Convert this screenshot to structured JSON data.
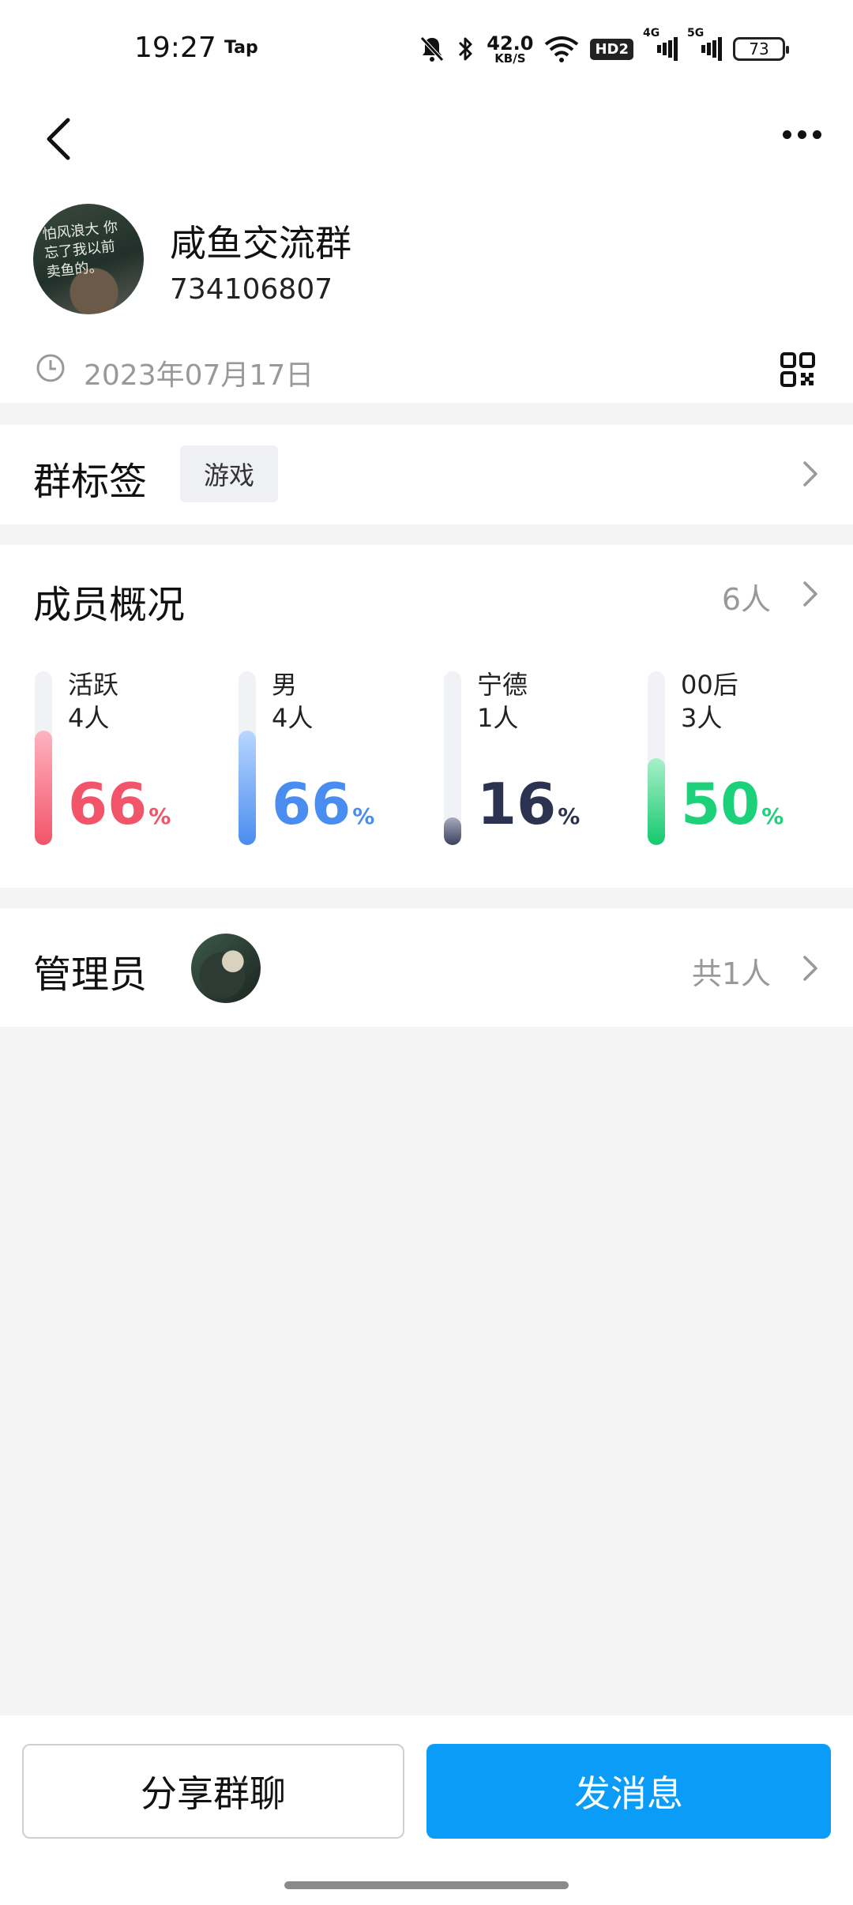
{
  "status_bar": {
    "time": "19:27",
    "app_tag": "Tap",
    "net_speed_value": "42.0",
    "net_speed_unit": "KB/S",
    "hd_label": "HD2",
    "sim1_label": "4G",
    "sim2_label": "5G",
    "battery": "73"
  },
  "group": {
    "name": "咸鱼交流群",
    "id": "734106807",
    "created_date": "2023年07月17日",
    "avatar_text": "怕风浪大 你忘了我以前 卖鱼的。"
  },
  "tags": {
    "title": "群标签",
    "items": [
      "游戏"
    ]
  },
  "members": {
    "title": "成员概况",
    "count": "6人",
    "stats": [
      {
        "label": "活跃",
        "count": "4人",
        "percent": 66,
        "percent_sign": "%",
        "color": "#f2546a",
        "fill_top": "#ffb3c0",
        "fill_bottom": "#f2546a"
      },
      {
        "label": "男",
        "count": "4人",
        "percent": 66,
        "percent_sign": "%",
        "color": "#4a8df0",
        "fill_top": "#b9d6ff",
        "fill_bottom": "#4a8df0"
      },
      {
        "label": "宁德",
        "count": "1人",
        "percent": 16,
        "percent_sign": "%",
        "color": "#2b3350",
        "fill_top": "#a7abbd",
        "fill_bottom": "#3a4160"
      },
      {
        "label": "00后",
        "count": "3人",
        "percent": 50,
        "percent_sign": "%",
        "color": "#1dd17a",
        "fill_top": "#a9f0c9",
        "fill_bottom": "#14c96e"
      }
    ]
  },
  "admins": {
    "title": "管理员",
    "count": "共1人"
  },
  "actions": {
    "share_label": "分享群聊",
    "send_label": "发消息"
  },
  "colors": {
    "primary": "#0a9cf7",
    "background": "#f4f4f5"
  }
}
